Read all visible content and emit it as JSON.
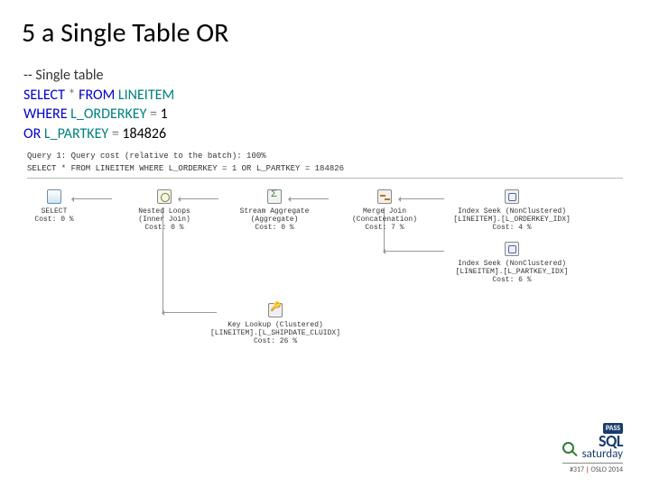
{
  "title": "5 a Single Table OR",
  "sql": {
    "comment": "-- Single table",
    "line1_select": "SELECT",
    "line1_star": " * ",
    "line1_from": "FROM",
    "line1_table": " LINEITEM",
    "line2_where": "WHERE",
    "line2_col": " L_ORDERKEY ",
    "line2_eq": "=",
    "line2_val": " 1",
    "line3_indent": "  ",
    "line3_or": "OR",
    "line3_col": " L_PARTKEY ",
    "line3_eq": "=",
    "line3_val": " 184826"
  },
  "plan": {
    "header1": "Query 1: Query cost (relative to the batch): 100%",
    "header2": "SELECT * FROM LINEITEM WHERE L_ORDERKEY = 1 OR L_PARTKEY = 184826",
    "nodes": {
      "select": "SELECT\nCost: 0 %",
      "loop": "Nested Loops\n(Inner Join)\nCost: 0 %",
      "agg": "Stream Aggregate\n(Aggregate)\nCost: 0 %",
      "merge": "Merge Join\n(Concatenation)\nCost: 7 %",
      "seek1": "Index Seek (NonClustered)\n[LINEITEM].[L_ORDERKEY_IDX]\nCost: 4 %",
      "seek2": "Index Seek (NonClustered)\n[LINEITEM].[L_PARTKEY_IDX]\nCost: 6 %",
      "keylkp": "Key Lookup (Clustered)\n[LINEITEM].[L_SHIPDATE_CLUIDX]\nCost: 26 %"
    }
  },
  "footer": {
    "pass": "PASS",
    "sql": "SQL",
    "sat": "saturday",
    "sub_num": "#317",
    "sub_loc": "OSLO 2014"
  }
}
